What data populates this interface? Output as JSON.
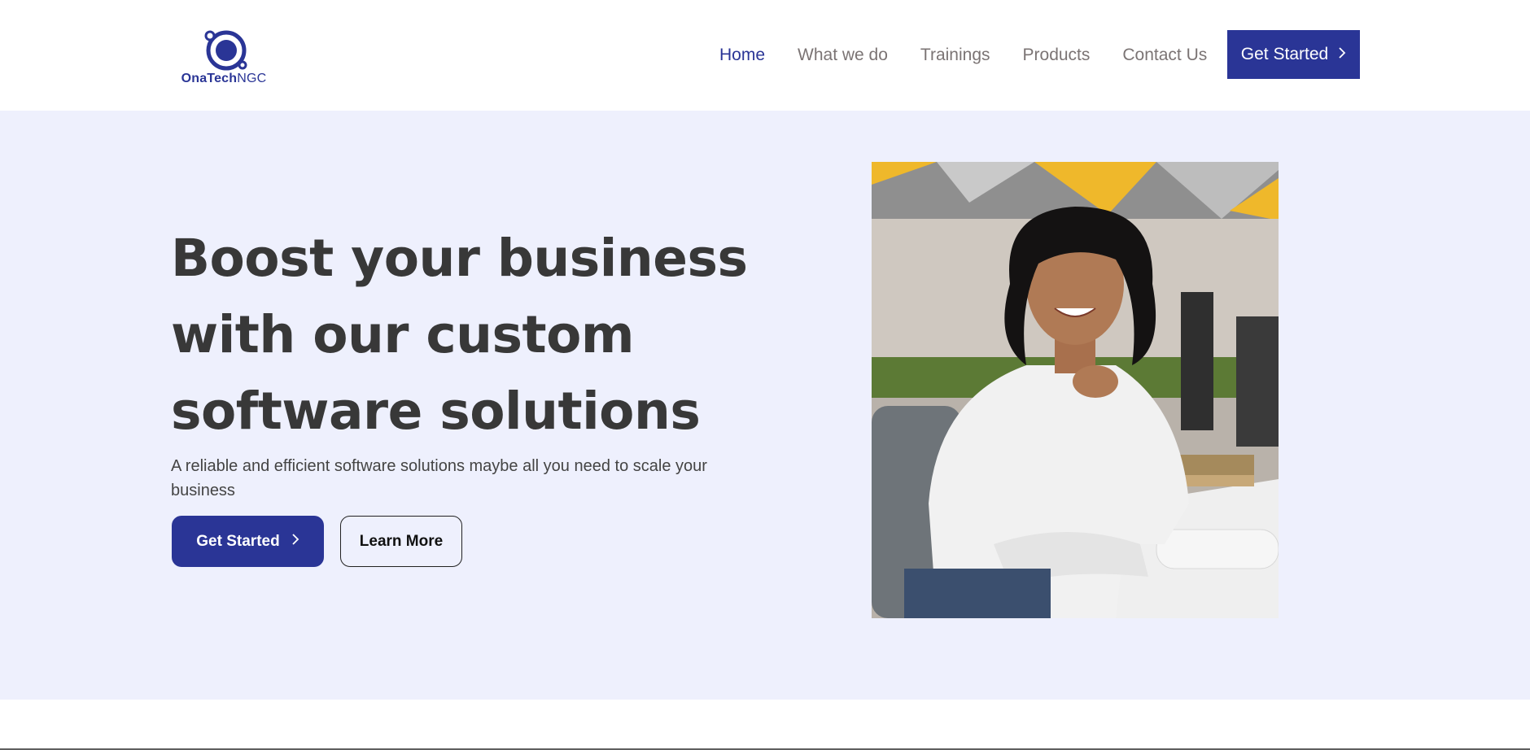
{
  "brand": {
    "name_bold": "OnaTech",
    "name_light": "NGC",
    "color": "#2a3596"
  },
  "nav": {
    "items": [
      {
        "label": "Home",
        "active": true
      },
      {
        "label": "What we do",
        "active": false
      },
      {
        "label": "Trainings",
        "active": false
      },
      {
        "label": "Products",
        "active": false
      },
      {
        "label": "Contact Us",
        "active": false
      }
    ],
    "cta_label": "Get Started",
    "cta_icon": "chevron-right-icon"
  },
  "hero": {
    "title": "Boost your business with our custom software solutions",
    "subtitle": "A reliable and efficient software solutions maybe all you need to scale your business",
    "primary_button": "Get Started",
    "secondary_button": "Learn More",
    "background": "#eef0fd",
    "image_subject": "smiling-woman-at-office-desk-photo"
  }
}
